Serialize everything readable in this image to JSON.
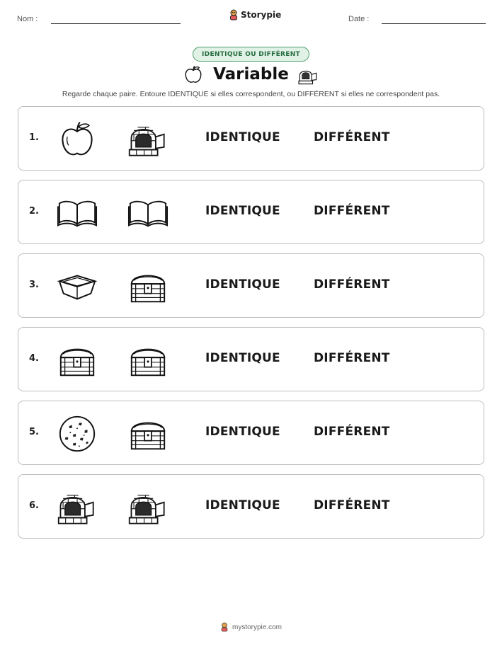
{
  "header": {
    "name_label": "Nom :",
    "date_label": "Date :",
    "brand": "Storypie"
  },
  "badge": "IDENTIQUE OU DIFFÉRENT",
  "title": "Variable",
  "title_icons": [
    "apple-icon",
    "brick-oven-icon"
  ],
  "instructions": "Regarde chaque paire. Entoure IDENTIQUE si elles correspondent, ou DIFFÉRENT si elles ne correspondent pas.",
  "options": {
    "same": "IDENTIQUE",
    "different": "DIFFÉRENT"
  },
  "rows": [
    {
      "number": "1.",
      "left": "apple-icon",
      "right": "brick-oven-icon"
    },
    {
      "number": "2.",
      "left": "open-book-icon",
      "right": "open-book-icon"
    },
    {
      "number": "3.",
      "left": "square-dish-icon",
      "right": "treasure-chest-icon"
    },
    {
      "number": "4.",
      "left": "treasure-chest-icon",
      "right": "treasure-chest-icon"
    },
    {
      "number": "5.",
      "left": "cookie-icon",
      "right": "treasure-chest-icon"
    },
    {
      "number": "6.",
      "left": "brick-oven-icon",
      "right": "brick-oven-icon"
    }
  ],
  "footer": "mystorypie.com",
  "colors": {
    "badge_bg": "#e0f2e5",
    "badge_border": "#4f9a6a",
    "badge_text": "#276b40",
    "row_border": "#bdbdbd"
  }
}
